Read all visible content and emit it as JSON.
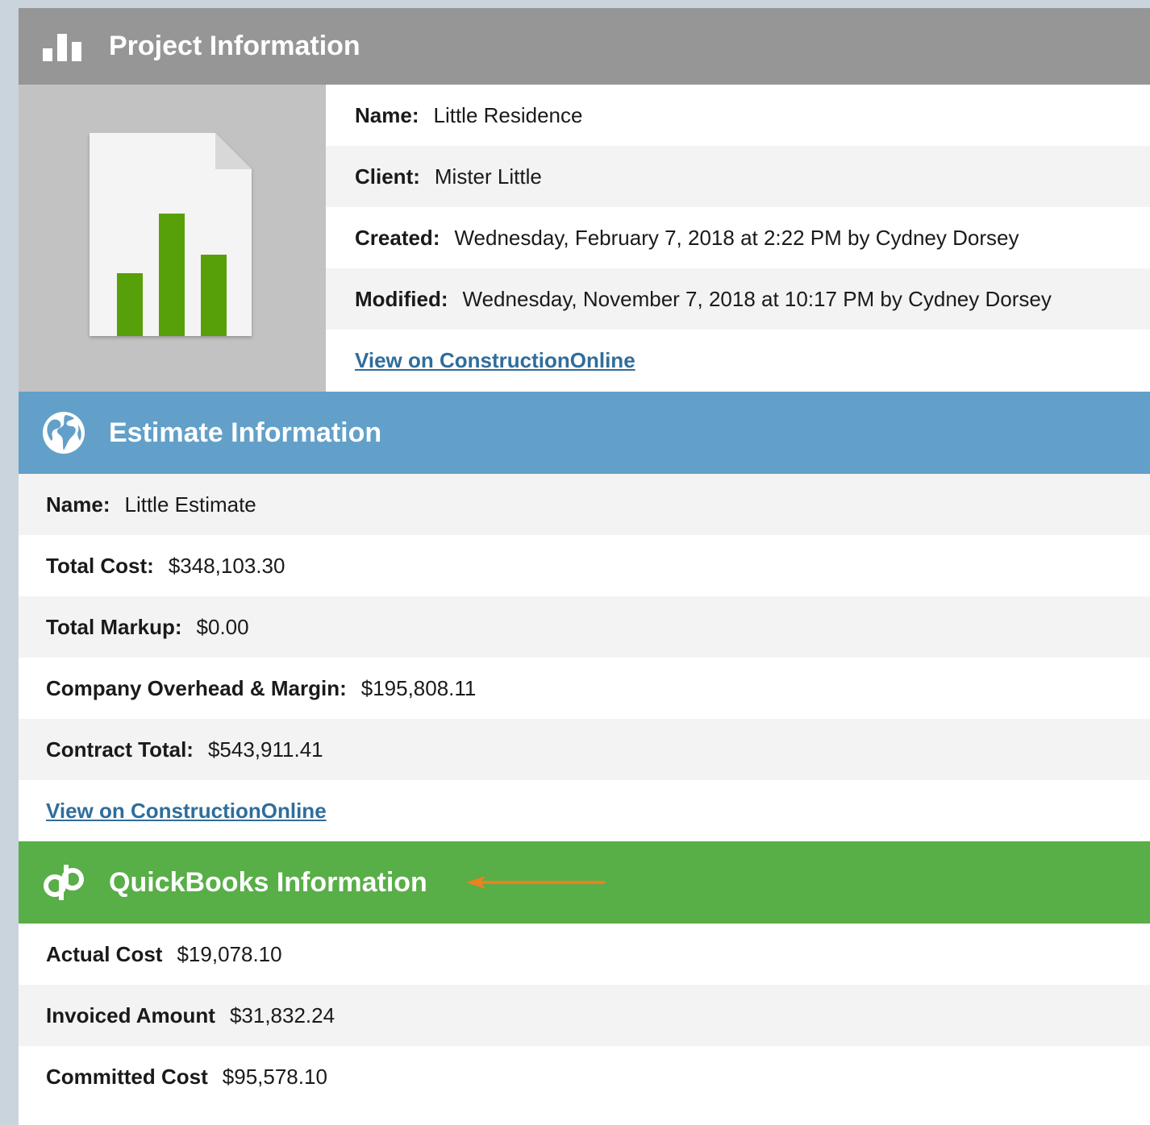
{
  "project": {
    "title": "Project Information",
    "rows": [
      {
        "label": "Name:",
        "value": "Little Residence"
      },
      {
        "label": "Client:",
        "value": "Mister Little"
      },
      {
        "label": "Created:",
        "value": "Wednesday, February 7, 2018 at 2:22 PM by Cydney Dorsey"
      },
      {
        "label": "Modified:",
        "value": "Wednesday, November 7, 2018 at 10:17 PM by Cydney Dorsey"
      }
    ],
    "link": "View on ConstructionOnline"
  },
  "estimate": {
    "title": "Estimate Information",
    "rows": [
      {
        "label": "Name:",
        "value": "Little Estimate"
      },
      {
        "label": "Total Cost:",
        "value": "$348,103.30"
      },
      {
        "label": "Total Markup:",
        "value": "$0.00"
      },
      {
        "label": "Company Overhead & Margin:",
        "value": "$195,808.11"
      },
      {
        "label": "Contract Total:",
        "value": "$543,911.41"
      }
    ],
    "link": "View on ConstructionOnline"
  },
  "quickbooks": {
    "title": "QuickBooks Information",
    "rows": [
      {
        "label": "Actual Cost",
        "value": "$19,078.10"
      },
      {
        "label": "Invoiced Amount",
        "value": "$31,832.24"
      },
      {
        "label": "Committed Cost",
        "value": "$95,578.10"
      }
    ]
  },
  "colors": {
    "project_header": "#969696",
    "estimate_header": "#62a0c9",
    "quickbooks_header": "#58ae47",
    "link": "#2f6d9c",
    "chart_bar": "#58a00a",
    "arrow": "#f07f1e"
  },
  "icons": {
    "project": "bar-chart-icon",
    "estimate": "globe-icon",
    "quickbooks": "quickbooks-logo-icon",
    "thumbnail": "chart-document-icon",
    "annotation": "arrow-left-icon"
  }
}
